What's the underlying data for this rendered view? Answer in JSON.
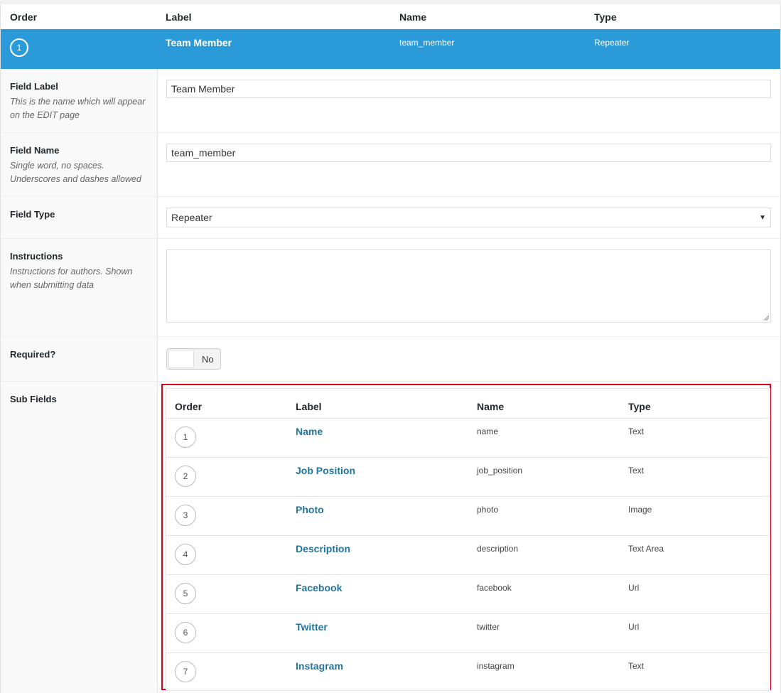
{
  "header": {
    "order": "Order",
    "label": "Label",
    "name": "Name",
    "type": "Type"
  },
  "selected_field": {
    "order": "1",
    "label": "Team Member",
    "name": "team_member",
    "type": "Repeater"
  },
  "settings": {
    "field_label": {
      "title": "Field Label",
      "desc": "This is the name which will appear on the EDIT page",
      "value": "Team Member"
    },
    "field_name": {
      "title": "Field Name",
      "desc": "Single word, no spaces. Underscores and dashes allowed",
      "value": "team_member"
    },
    "field_type": {
      "title": "Field Type",
      "value": "Repeater"
    },
    "instructions": {
      "title": "Instructions",
      "desc": "Instructions for authors. Shown when submitting data",
      "value": ""
    },
    "required": {
      "title": "Required?",
      "value": "No"
    },
    "sub_fields": {
      "title": "Sub Fields"
    }
  },
  "sub_fields": {
    "headers": {
      "order": "Order",
      "label": "Label",
      "name": "Name",
      "type": "Type"
    },
    "rows": [
      {
        "order": "1",
        "label": "Name",
        "name": "name",
        "type": "Text"
      },
      {
        "order": "2",
        "label": "Job Position",
        "name": "job_position",
        "type": "Text"
      },
      {
        "order": "3",
        "label": "Photo",
        "name": "photo",
        "type": "Image"
      },
      {
        "order": "4",
        "label": "Description",
        "name": "description",
        "type": "Text Area"
      },
      {
        "order": "5",
        "label": "Facebook",
        "name": "facebook",
        "type": "Url"
      },
      {
        "order": "6",
        "label": "Twitter",
        "name": "twitter",
        "type": "Url"
      },
      {
        "order": "7",
        "label": "Instagram",
        "name": "instagram",
        "type": "Text"
      }
    ]
  },
  "colors": {
    "selected_row_bg": "#2a9bd8",
    "link": "#21759b",
    "highlight_border": "#d9001b"
  }
}
